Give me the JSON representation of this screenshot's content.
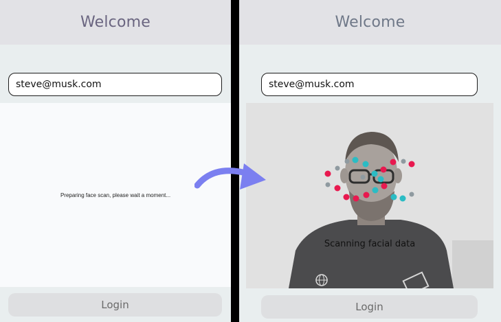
{
  "left": {
    "title": "Welcome",
    "email_value": "steve@musk.com",
    "status_text": "Preparing face scan, please wait a moment...",
    "login_label": "Login"
  },
  "right": {
    "title": "Welcome",
    "email_value": "steve@musk.com",
    "scan_text": "Scanning facial data",
    "login_label": "Login"
  },
  "colors": {
    "accent_arrow": "#7b7ff0",
    "dot_pink": "#e8194f",
    "dot_teal": "#2bbcc4",
    "dot_gray": "#8f9aa0"
  },
  "icons": [
    "curved-arrow-icon"
  ]
}
